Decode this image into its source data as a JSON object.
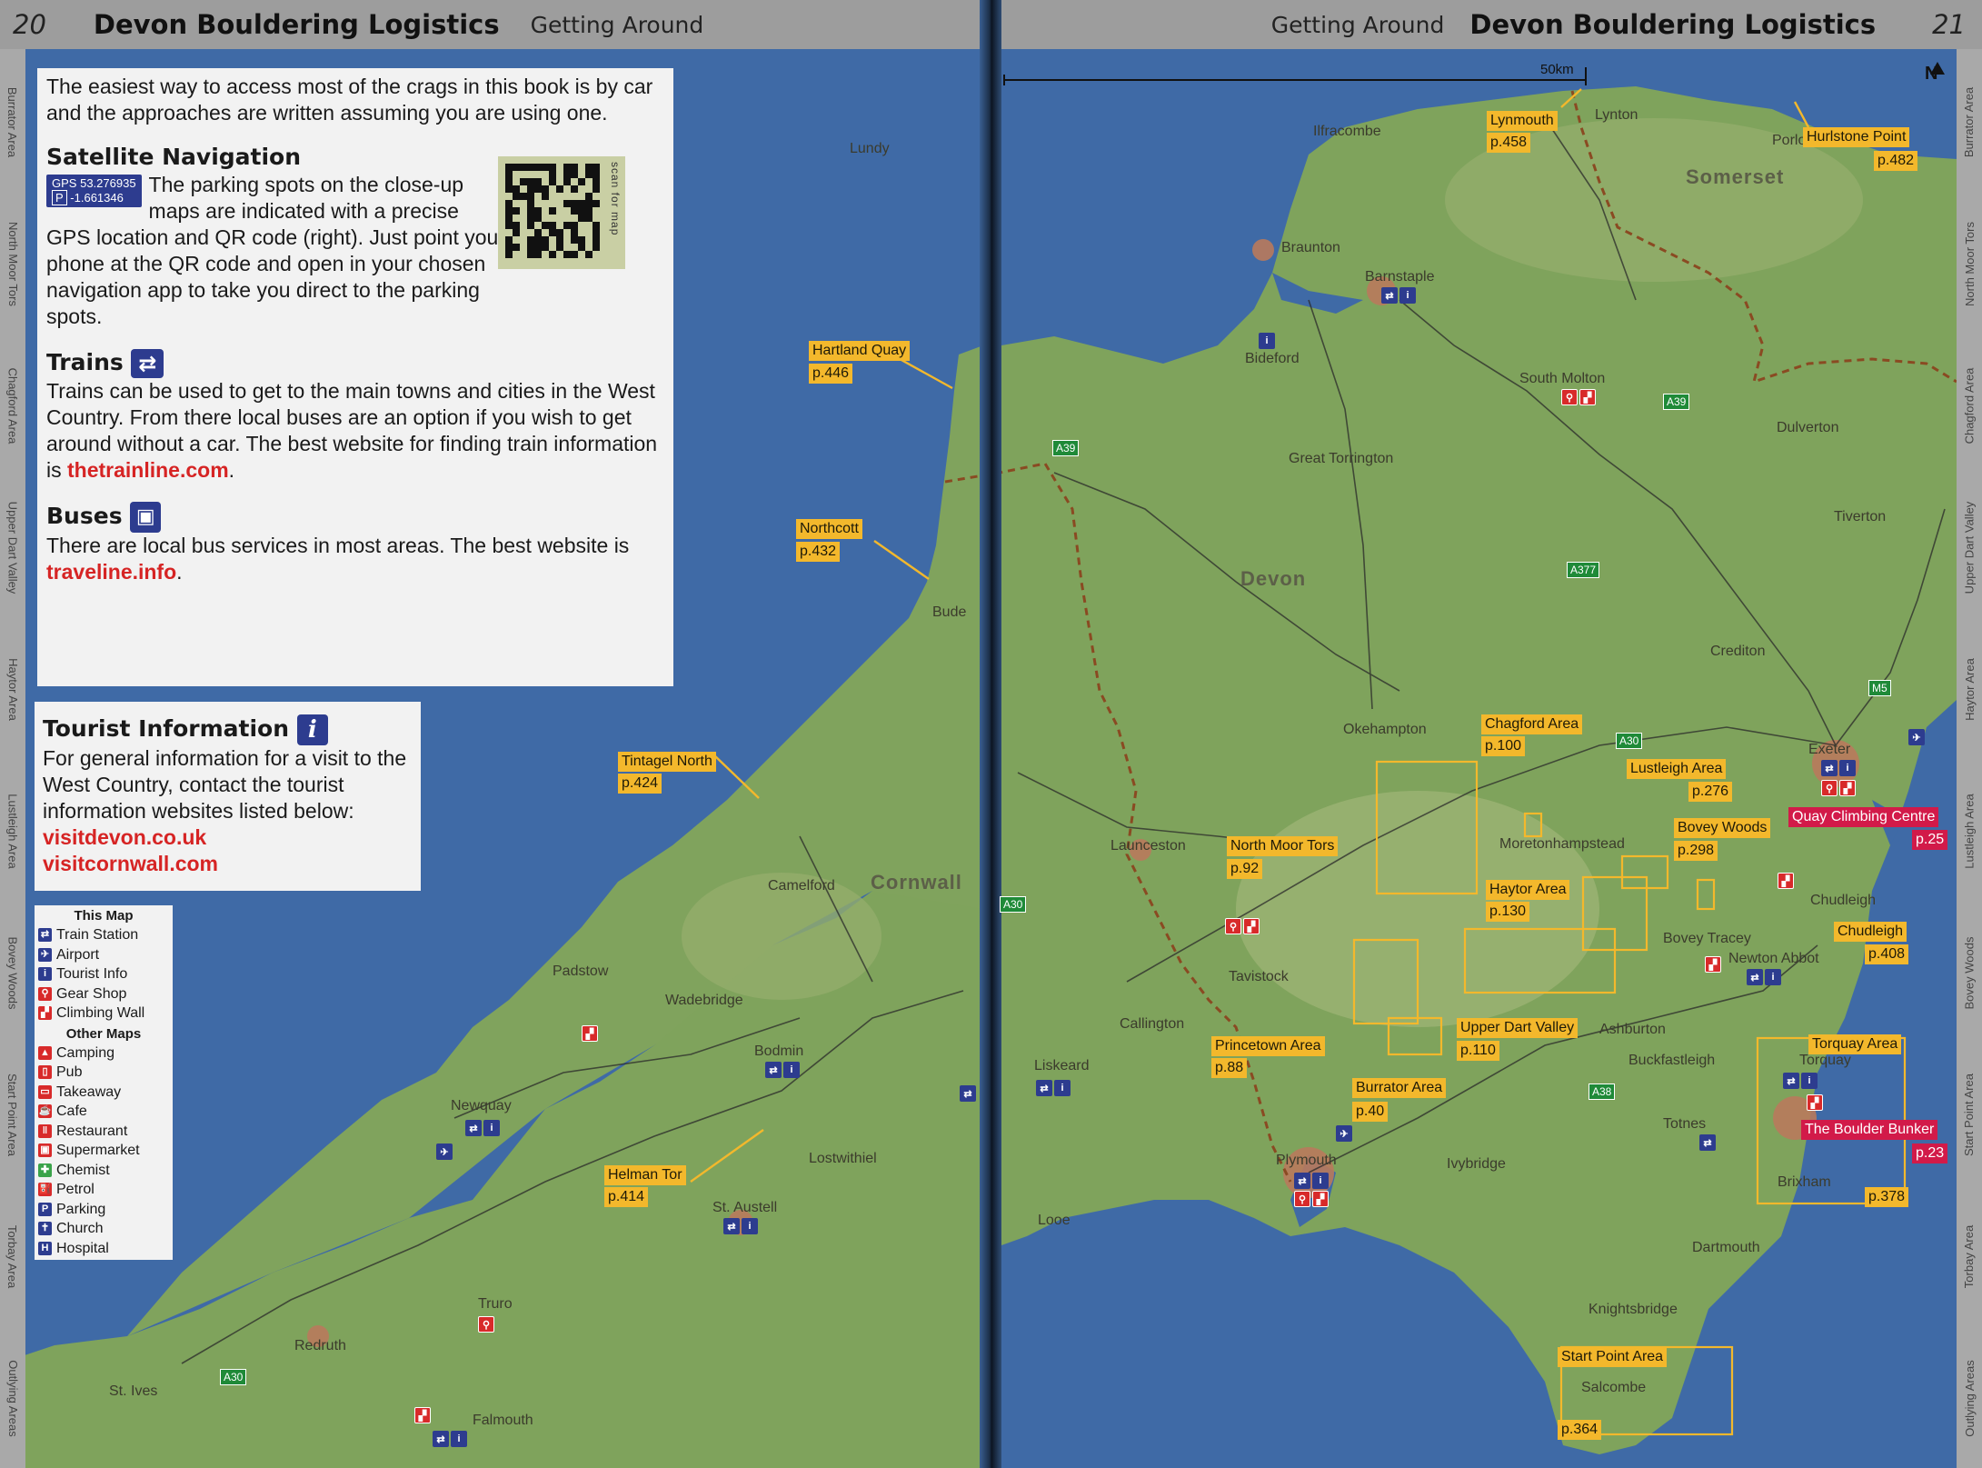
{
  "header": {
    "left": {
      "page_number": "20",
      "book_title": "Devon Bouldering Logistics",
      "section": "Getting Around"
    },
    "right": {
      "page_number": "21",
      "book_title": "Devon Bouldering Logistics",
      "section": "Getting Around"
    }
  },
  "side_tabs": {
    "left": [
      "Burrator Area",
      "North Moor Tors",
      "Chagford Area",
      "Upper Dart Valley",
      "Haytor Area",
      "Lustleigh Area",
      "Bovey Woods",
      "Start Point Area",
      "Torbay Area",
      "Outlying Areas"
    ],
    "right": [
      "Burrator Area",
      "North Moor Tors",
      "Chagford Area",
      "Upper Dart Valley",
      "Haytor Area",
      "Lustleigh Area",
      "Bovey Woods",
      "Start Point Area",
      "Torbay Area",
      "Outlying Areas"
    ]
  },
  "intro_text": "The easiest way to access most of the crags in this book is by car and the approaches are written assuming you are using one.",
  "satnav": {
    "heading": "Satellite Navigation",
    "gps_label": "GPS",
    "gps_lat": "53.276935",
    "parking_label": "P",
    "gps_lon": "-1.661346",
    "text": "The parking spots on the close-up maps are indicated with a precise GPS location and QR code (right). Just point your phone at the QR code and open in your chosen navigation app to take you direct to the parking spots.",
    "qr_caption": "scan for map"
  },
  "trains": {
    "heading": "Trains",
    "text": "Trains can be used to get to the main towns and cities in the West Country. From there local buses are an option if you wish to get around without a car. The best website for finding train information is",
    "link": "thetrainline.com",
    "end": "."
  },
  "buses": {
    "heading": "Buses",
    "text": "There are local bus services in most areas. The best website is",
    "link": "traveline.info",
    "end": "."
  },
  "tourist": {
    "heading": "Tourist Information",
    "icon_letter": "i",
    "text": "For general information for a visit to the West Country, contact the tourist information websites listed below:",
    "links": [
      "visitdevon.co.uk",
      "visitcornwall.com"
    ]
  },
  "legend": {
    "this_map_title": "This Map",
    "this_map": [
      {
        "icon": "train-icon",
        "glyph": "⇄",
        "label": "Train Station",
        "color": "#2d3c8f"
      },
      {
        "icon": "airport-icon",
        "glyph": "✈",
        "label": "Airport",
        "color": "#2d3c8f"
      },
      {
        "icon": "tourist-info-icon",
        "glyph": "i",
        "label": "Tourist Info",
        "color": "#2d3c8f"
      },
      {
        "icon": "gear-shop-icon",
        "glyph": "⚲",
        "label": "Gear Shop",
        "color": "#d82a2a"
      },
      {
        "icon": "climbing-wall-icon",
        "glyph": "▞",
        "label": "Climbing Wall",
        "color": "#d82a2a"
      }
    ],
    "other_maps_title": "Other Maps",
    "other_maps": [
      {
        "icon": "camping-icon",
        "glyph": "▲",
        "label": "Camping",
        "color": "#d82a2a"
      },
      {
        "icon": "pub-icon",
        "glyph": "▯",
        "label": "Pub",
        "color": "#d82a2a"
      },
      {
        "icon": "takeaway-icon",
        "glyph": "▭",
        "label": "Takeaway",
        "color": "#d82a2a"
      },
      {
        "icon": "cafe-icon",
        "glyph": "☕",
        "label": "Cafe",
        "color": "#d82a2a"
      },
      {
        "icon": "restaurant-icon",
        "glyph": "‖",
        "label": "Restaurant",
        "color": "#d82a2a"
      },
      {
        "icon": "supermarket-icon",
        "glyph": "▣",
        "label": "Supermarket",
        "color": "#d82a2a"
      },
      {
        "icon": "chemist-icon",
        "glyph": "✚",
        "label": "Chemist",
        "color": "#3aa34a"
      },
      {
        "icon": "petrol-icon",
        "glyph": "⛽",
        "label": "Petrol",
        "color": "#d82a2a"
      },
      {
        "icon": "parking-icon",
        "glyph": "P",
        "label": "Parking",
        "color": "#2d3c8f"
      },
      {
        "icon": "church-icon",
        "glyph": "✝",
        "label": "Church",
        "color": "#2d3c8f"
      },
      {
        "icon": "hospital-icon",
        "glyph": "H",
        "label": "Hospital",
        "color": "#2d3c8f"
      }
    ]
  },
  "map": {
    "scale_label": "50km",
    "north_label": "N",
    "regions": [
      "Somerset",
      "Devon",
      "Cornwall"
    ],
    "places": [
      "Lundy",
      "Ilfracombe",
      "Lynton",
      "Porlock",
      "Braunton",
      "Barnstaple",
      "Bideford",
      "South Molton",
      "Dulverton",
      "Great Torrington",
      "Tiverton",
      "Bude",
      "Crediton",
      "Okehampton",
      "Exeter",
      "Moretonhampstead",
      "Launceston",
      "Chudleigh",
      "Bovey Tracey",
      "Newton Abbot",
      "Tavistock",
      "Camelford",
      "Callington",
      "Ashburton",
      "Buckfastleigh",
      "Liskeard",
      "Padstow",
      "Wadebridge",
      "Bodmin",
      "Torquay",
      "Newquay",
      "Lostwithiel",
      "Totnes",
      "Plymouth",
      "Ivybridge",
      "Brixham",
      "St. Austell",
      "Looe",
      "Dartmouth",
      "Truro",
      "Knightsbridge",
      "Redruth",
      "Salcombe",
      "St. Ives",
      "Falmouth"
    ],
    "area_tags": [
      {
        "name": "Lynmouth",
        "page": "p.458"
      },
      {
        "name": "Hurlstone Point",
        "page": "p.482"
      },
      {
        "name": "Hartland Quay",
        "page": "p.446"
      },
      {
        "name": "Northcott",
        "page": "p.432"
      },
      {
        "name": "Tintagel North",
        "page": "p.424"
      },
      {
        "name": "Helman Tor",
        "page": "p.414"
      },
      {
        "name": "Chagford Area",
        "page": "p.100"
      },
      {
        "name": "Lustleigh Area",
        "page": "p.276"
      },
      {
        "name": "Bovey Woods",
        "page": "p.298"
      },
      {
        "name": "North Moor Tors",
        "page": "p.92"
      },
      {
        "name": "Haytor Area",
        "page": "p.130"
      },
      {
        "name": "Chudleigh",
        "page": "p.408"
      },
      {
        "name": "Princetown Area",
        "page": "p.88"
      },
      {
        "name": "Upper Dart Valley",
        "page": "p.110"
      },
      {
        "name": "Burrator Area",
        "page": "p.40"
      },
      {
        "name": "Torquay Area",
        "page": "p.378"
      },
      {
        "name": "Start Point Area",
        "page": "p.364"
      }
    ],
    "wall_tags": [
      {
        "name": "Quay Climbing Centre",
        "page": "p.25"
      },
      {
        "name": "The Boulder Bunker",
        "page": "p.23"
      }
    ],
    "roads": [
      "A39",
      "A39",
      "A377",
      "A30",
      "M5",
      "A38",
      "A30",
      "A30"
    ]
  },
  "colors": {
    "sea": "#3f6aa6",
    "land": "#7fa35c",
    "moor": "#9ab372",
    "urban": "#b97a5c",
    "tag": "#f3b82c",
    "wall_tag": "#d21a49",
    "link": "#d62424"
  }
}
